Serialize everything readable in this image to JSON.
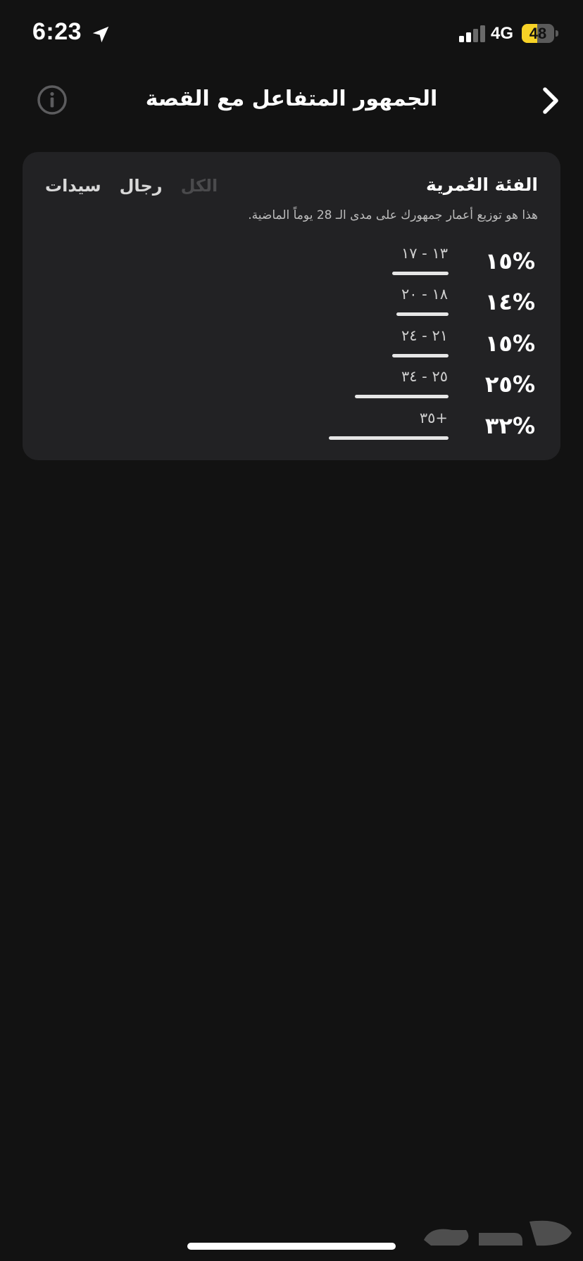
{
  "status_bar": {
    "time": "6:23",
    "network": "4G",
    "battery_level": "48",
    "battery_fraction": 0.48,
    "accent_color": "#f7d226"
  },
  "header": {
    "title": "الجمهور المتفاعل مع القصة",
    "left_icon": "info-icon",
    "right_icon": "chevron-right-icon"
  },
  "card": {
    "title": "الفئة العُمرية",
    "subtitle": "هذا هو توزيع أعمار جمهورك على مدى الـ 28 يوماً الماضية.",
    "filters": [
      {
        "label": "سيدات",
        "active": false
      },
      {
        "label": "رجال",
        "active": false
      },
      {
        "label": "الكل",
        "active": true
      }
    ],
    "rows": [
      {
        "percent": "%١٥",
        "range": "١٣ - ١٧",
        "value": 15
      },
      {
        "percent": "%١٤",
        "range": "١٨ - ٢٠",
        "value": 14
      },
      {
        "percent": "%١٥",
        "range": "٢١ - ٢٤",
        "value": 15
      },
      {
        "percent": "%٢٥",
        "range": "٢٥ - ٣٤",
        "value": 25
      },
      {
        "percent": "%٣٢",
        "range": "+٣٥",
        "value": 32
      }
    ]
  }
}
